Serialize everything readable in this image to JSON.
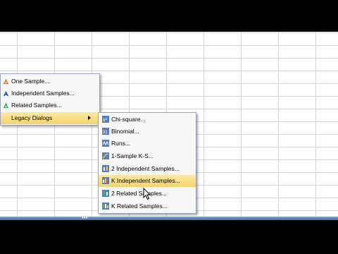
{
  "left_menu": {
    "items": [
      {
        "label": "One Sample...",
        "icon": "one-sample-icon"
      },
      {
        "label": "Independent Samples...",
        "icon": "independent-samples-icon"
      },
      {
        "label": "Related Samples...",
        "icon": "related-samples-icon"
      },
      {
        "label": "Legacy Dialogs",
        "icon": "none",
        "highlighted": true
      }
    ]
  },
  "legacy_menu": {
    "items": [
      {
        "label": "Chi-square...",
        "icon": "chi-square-icon"
      },
      {
        "label": "Binomial...",
        "icon": "binomial-icon"
      },
      {
        "label": "Runs...",
        "icon": "runs-icon"
      },
      {
        "label": "1-Sample K-S...",
        "icon": "ks-icon"
      },
      {
        "label": "2 Independent Samples...",
        "icon": "two-independent-icon"
      },
      {
        "label": "K Independent Samples...",
        "icon": "k-independent-icon",
        "highlighted": true
      },
      {
        "label": "2 Related Samples...",
        "icon": "two-related-icon"
      },
      {
        "label": "K Related Samples...",
        "icon": "k-related-icon"
      }
    ]
  },
  "status_bar": {
    "grip": "•••"
  },
  "colors": {
    "highlight": "#f6d46b",
    "status_bar": "#3f6fa8",
    "menu_bg": "#f7f7f7"
  }
}
